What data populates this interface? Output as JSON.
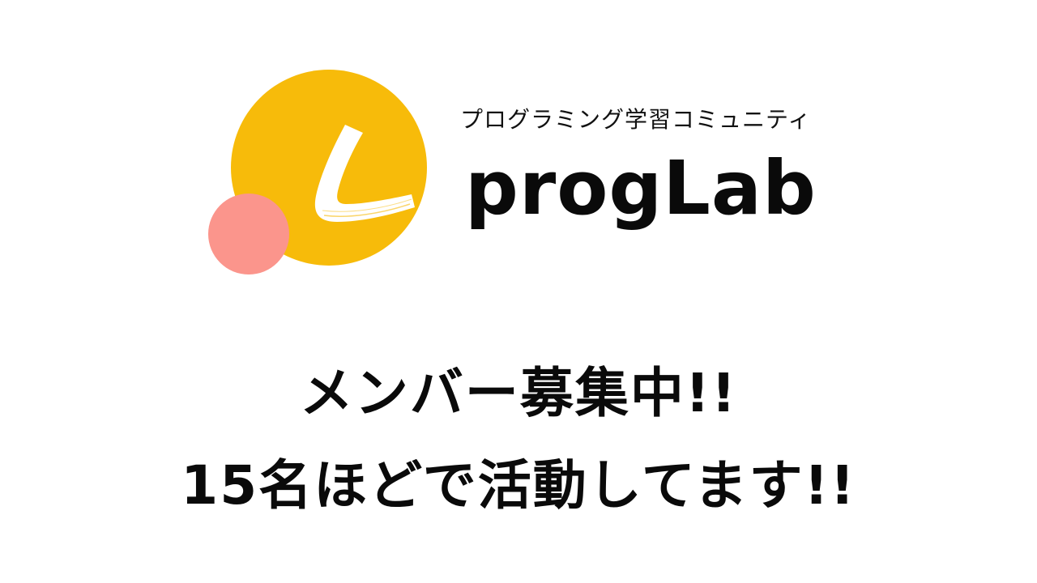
{
  "logo": {
    "icon": "proglab-l-logo-icon",
    "colors": {
      "main_circle": "#F7BB0A",
      "small_circle": "#FB958C",
      "letter": "#FFFFFF"
    }
  },
  "header": {
    "tagline": "プログラミング学習コミュニティ",
    "brand_name": "progLab"
  },
  "main": {
    "headline": "メンバー募集中!!",
    "subheadline": "15名ほどで活動してます!!"
  }
}
